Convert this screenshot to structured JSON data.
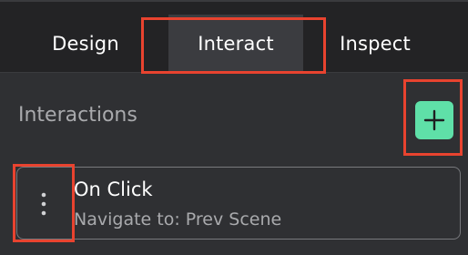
{
  "tabs": {
    "design": "Design",
    "interact": "Interact",
    "inspect": "Inspect",
    "active": "Interact"
  },
  "section": {
    "title": "Interactions",
    "add_icon": "plus-icon"
  },
  "interaction": {
    "trigger": "On Click",
    "action": "Navigate to: Prev Scene",
    "menu_icon": "kebab-menu-icon"
  },
  "colors": {
    "accent": "#5fe0a8",
    "highlight": "#e8432f",
    "panel_bg": "#2f3033",
    "tabbar_bg": "#232325"
  }
}
